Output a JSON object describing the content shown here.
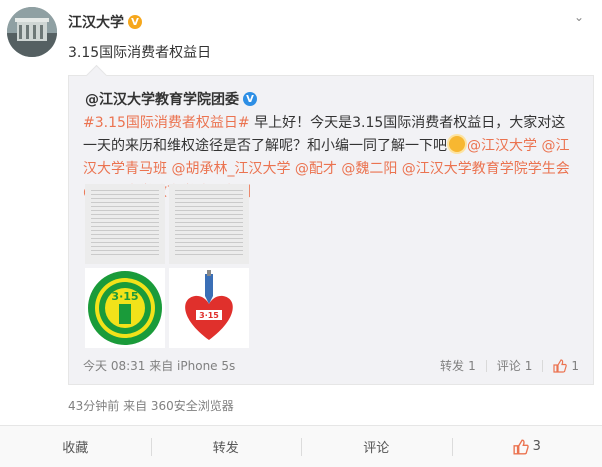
{
  "post": {
    "author": "江汉大学",
    "text": "3.15国际消费者权益日",
    "meta": "43分钟前 来自 360安全浏览器"
  },
  "retweet": {
    "author": "@江汉大学教育学院团委",
    "tag": "#3.15国际消费者权益日#",
    "body": " 早上好！今天是3.15国际消费者权益日，大家对这一天的来历和维权途径是否了解呢？和小编一同了解一下吧",
    "mentions": "@江汉大学 @江汉大学青马班 @胡承林_江汉大学 @配才 @魏二阳 @江汉大学教育学院学生会 @江汉大学教育学院记者团",
    "time": "今天 08:31",
    "source": "来自 iPhone 5s",
    "repost_label": "转发",
    "repost_count": "1",
    "comment_label": "评论",
    "comment_count": "1",
    "like_count": "1",
    "logo_text": "3·15"
  },
  "footer": {
    "collect": "收藏",
    "repost": "转发",
    "comment": "评论",
    "like_count": "3"
  },
  "colors": {
    "link": "#eb7350",
    "badge": "#f6a71c"
  },
  "icons": [
    "avatar",
    "verified-badge",
    "chevron-down-icon",
    "repost-icon",
    "comment-icon",
    "like-icon",
    "sun-emoji-icon"
  ]
}
